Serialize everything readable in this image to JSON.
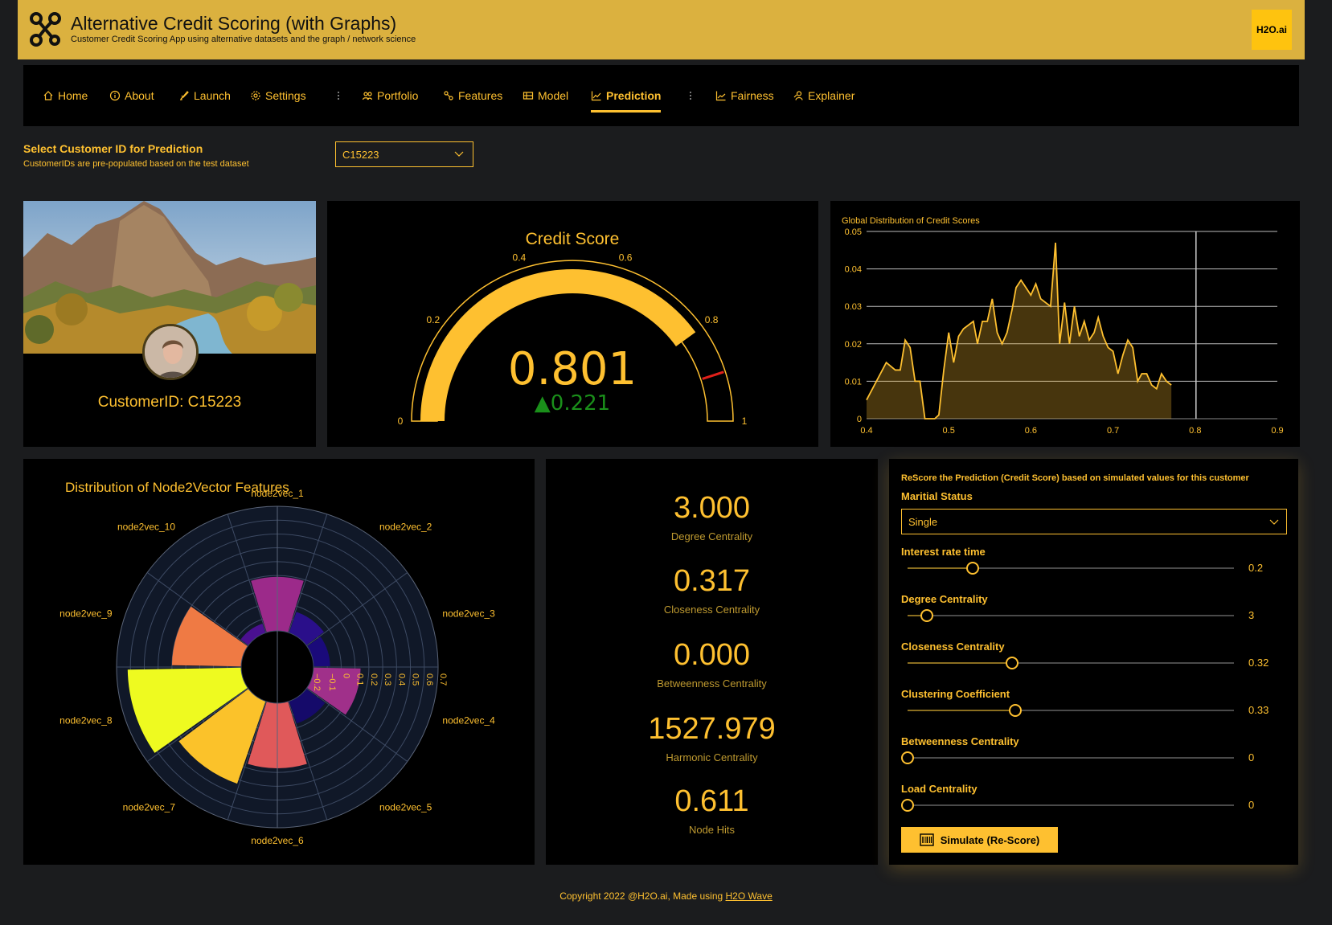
{
  "header": {
    "title": "Alternative Credit Scoring (with Graphs)",
    "subtitle": "Customer Credit Scoring App using alternative datasets and the graph / network science",
    "badge": "H2O.ai"
  },
  "nav": {
    "items": [
      {
        "label": "Home",
        "icon": "home-icon"
      },
      {
        "label": "About",
        "icon": "info-icon"
      },
      {
        "label": "Launch",
        "icon": "rocket-icon"
      },
      {
        "label": "Settings",
        "icon": "gear-icon"
      },
      {
        "label": "Portfolio",
        "icon": "portfolio-icon"
      },
      {
        "label": "Features",
        "icon": "features-icon"
      },
      {
        "label": "Model",
        "icon": "model-icon"
      },
      {
        "label": "Prediction",
        "icon": "chart-line-icon",
        "active": true
      },
      {
        "label": "Fairness",
        "icon": "fairness-icon"
      },
      {
        "label": "Explainer",
        "icon": "explainer-icon"
      }
    ]
  },
  "customer_select": {
    "title": "Select Customer ID for Prediction",
    "subtitle": "CustomerIDs are pre-populated based on the test dataset",
    "value": "C15223"
  },
  "profile": {
    "label": "CustomerID: C15223"
  },
  "colors": {
    "accent": "#fec030",
    "header_bg": "#dbb13f",
    "card_bg": "#000000",
    "page_bg": "#1b1c1e",
    "delta_green": "#1a8f1a"
  },
  "chart_data": [
    {
      "type": "gauge",
      "title": "Credit Score",
      "value": 0.801,
      "value_label": "0.801",
      "delta": "▲0.221",
      "range": [
        0,
        1
      ],
      "threshold": 0.9,
      "tick_labels": [
        "0",
        "0.2",
        "0.4",
        "0.6",
        "0.8",
        "1"
      ]
    },
    {
      "type": "area",
      "title": "Global Distribution of Credit Scores",
      "xlim": [
        0.4,
        0.9
      ],
      "ylim": [
        0,
        0.05
      ],
      "x_ticks": [
        "0.4",
        "0.5",
        "0.6",
        "0.7",
        "0.8",
        "0.9"
      ],
      "y_ticks": [
        "0",
        "0.01",
        "0.02",
        "0.03",
        "0.04",
        "0.05"
      ],
      "marker_x": 0.801,
      "grid": true,
      "x": [
        0.4,
        0.412,
        0.424,
        0.435,
        0.441,
        0.447,
        0.453,
        0.459,
        0.465,
        0.471,
        0.477,
        0.483,
        0.488,
        0.494,
        0.5,
        0.506,
        0.512,
        0.518,
        0.524,
        0.53,
        0.535,
        0.541,
        0.547,
        0.553,
        0.559,
        0.565,
        0.571,
        0.577,
        0.582,
        0.588,
        0.594,
        0.6,
        0.606,
        0.612,
        0.618,
        0.624,
        0.63,
        0.635,
        0.641,
        0.647,
        0.653,
        0.659,
        0.665,
        0.671,
        0.677,
        0.682,
        0.688,
        0.694,
        0.7,
        0.706,
        0.712,
        0.718,
        0.724,
        0.73,
        0.735,
        0.741,
        0.747,
        0.753,
        0.759,
        0.765,
        0.771,
        0.777,
        0.782,
        0.788,
        0.794,
        0.8,
        0.806,
        0.812,
        0.818,
        0.824,
        0.83,
        0.835,
        0.841,
        0.847,
        0.853,
        0.859,
        0.864
      ],
      "y": [
        0.005,
        0.01,
        0.015,
        0.013,
        0.013,
        0.021,
        0.019,
        0.01,
        0.01,
        0.0,
        0.0,
        0.0,
        0.001,
        0.013,
        0.023,
        0.015,
        0.022,
        0.024,
        0.025,
        0.026,
        0.02,
        0.026,
        0.026,
        0.032,
        0.023,
        0.02,
        0.023,
        0.029,
        0.035,
        0.037,
        0.035,
        0.033,
        0.036,
        0.032,
        0.031,
        0.03,
        0.047,
        0.02,
        0.031,
        0.02,
        0.03,
        0.022,
        0.026,
        0.021,
        0.023,
        0.027,
        0.022,
        0.019,
        0.018,
        0.012,
        0.017,
        0.021,
        0.019,
        0.01,
        0.012,
        0.012,
        0.009,
        0.008,
        0.012,
        0.01,
        0.009,
        0.0,
        0.0,
        0.0,
        0.0,
        0.0,
        0.0,
        0.0,
        0.0,
        0.0,
        0.0,
        0.0,
        0.0,
        0.0,
        0.0,
        0.0,
        0.0
      ]
    },
    {
      "type": "barpolar",
      "title": "Distribution of Node2Vector Features",
      "categories": [
        "node2vec_1",
        "node2vec_2",
        "node2vec_3",
        "node2vec_4",
        "node2vec_5",
        "node2vec_6",
        "node2vec_7",
        "node2vec_8",
        "node2vec_9",
        "node2vec_10"
      ],
      "values": [
        0.19,
        -0.04,
        -0.08,
        0.14,
        -0.03,
        0.27,
        0.43,
        0.62,
        0.3,
        -0.13
      ],
      "colors": [
        "#9c2a8a",
        "#2a0f8a",
        "#1a0a7a",
        "#a0308a",
        "#150a6a",
        "#e0595a",
        "#fbc22a",
        "#eefa20",
        "#ef7a44",
        "#4a1090"
      ],
      "radial_range": [
        -0.3,
        0.7
      ],
      "radial_ticks": [
        "−0.2",
        "−0.1",
        "0",
        "0.1",
        "0.2",
        "0.3",
        "0.4",
        "0.5",
        "0.6",
        "0.7"
      ]
    }
  ],
  "stats": [
    {
      "value": "3.000",
      "label": "Degree Centrality"
    },
    {
      "value": "0.317",
      "label": "Closeness Centrality"
    },
    {
      "value": "0.000",
      "label": "Betweenness Centrality"
    },
    {
      "value": "1527.979",
      "label": "Harmonic Centrality"
    },
    {
      "value": "0.611",
      "label": "Node Hits"
    }
  ],
  "simulator": {
    "title": "ReScore the Prediction (Credit Score) based on simulated values for this customer",
    "marital_label": "Maritial Status",
    "marital_value": "Single",
    "sliders": [
      {
        "label": "Interest rate time",
        "value_text": "0.2",
        "fraction": 0.2
      },
      {
        "label": "Degree Centrality",
        "value_text": "3",
        "fraction": 0.06
      },
      {
        "label": "Closeness Centrality",
        "value_text": "0.32",
        "fraction": 0.32
      },
      {
        "label": "Clustering Coefficient",
        "value_text": "0.33",
        "fraction": 0.33
      },
      {
        "label": "Betweenness Centrality",
        "value_text": "0",
        "fraction": 0
      },
      {
        "label": "Load Centrality",
        "value_text": "0",
        "fraction": 0
      }
    ],
    "button_label": "Simulate (Re-Score)"
  },
  "footer": {
    "text": "Copyright 2022 @H2O.ai, Made using ",
    "link": "H2O Wave"
  }
}
